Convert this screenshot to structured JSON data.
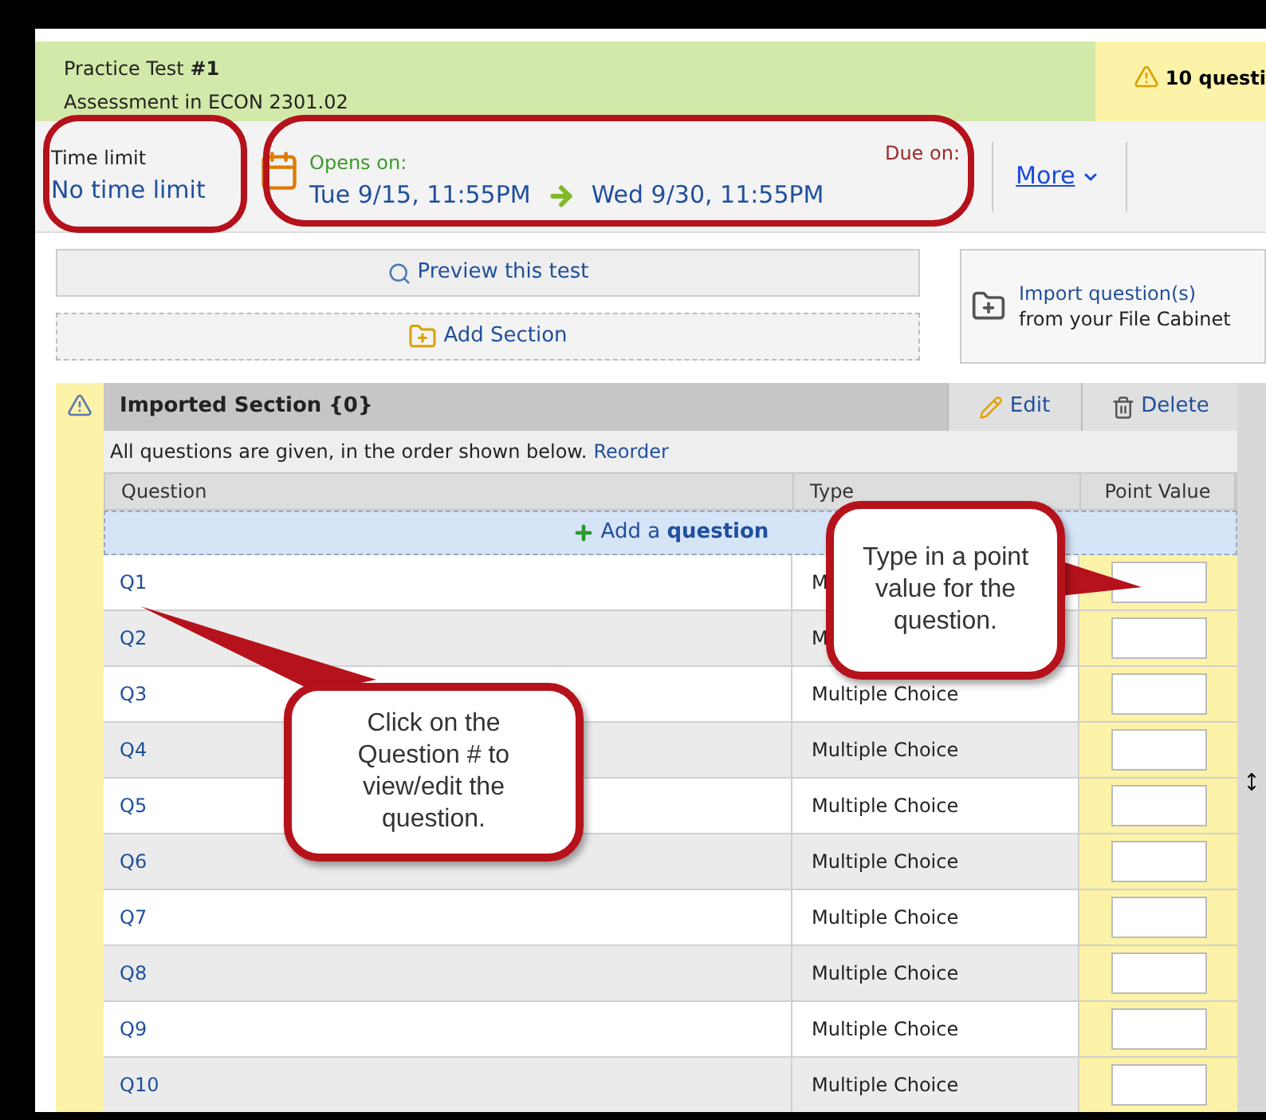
{
  "header": {
    "title": "Practice Test **#1**",
    "subtitle": "Assessment in ECON 2301.02",
    "questions_badge": "10 questi"
  },
  "time_limit": {
    "label": "Time limit",
    "value": "No time limit"
  },
  "schedule": {
    "opens_label": "Opens on:",
    "opens": "Tue 9/15, 11:55PM",
    "due_label": "Due on:",
    "due": "Wed 9/30, 11:55PM"
  },
  "more": "More",
  "actions": {
    "preview": "Preview this test",
    "add_section": "Add Section",
    "import_link": "Import question(s)",
    "import_note": "from your File Cabinet"
  },
  "section": {
    "title": "Imported Section {0}",
    "edit": "Edit",
    "delete": "Delete",
    "note": "All questions are given, in the order shown below.",
    "reorder": "Reorder",
    "columns": [
      "Question",
      "Type",
      "Point Value"
    ],
    "add_question": "Add a **question**",
    "rows": [
      {
        "question": "Q1",
        "type": "M"
      },
      {
        "question": "Q2",
        "type": "M"
      },
      {
        "question": "Q3",
        "type": "Multiple Choice"
      },
      {
        "question": "Q4",
        "type": "Multiple Choice"
      },
      {
        "question": "Q5",
        "type": "Multiple Choice"
      },
      {
        "question": "Q6",
        "type": "Multiple Choice"
      },
      {
        "question": "Q7",
        "type": "Multiple Choice"
      },
      {
        "question": "Q8",
        "type": "Multiple Choice"
      },
      {
        "question": "Q9",
        "type": "Multiple Choice"
      },
      {
        "question": "Q10",
        "type": "Multiple Choice"
      }
    ]
  },
  "callouts": [
    {
      "kind": "point-left",
      "text": "Click on the Question # to view/edit the question."
    },
    {
      "kind": "point-right",
      "text": "Type in a point value for the question."
    }
  ]
}
